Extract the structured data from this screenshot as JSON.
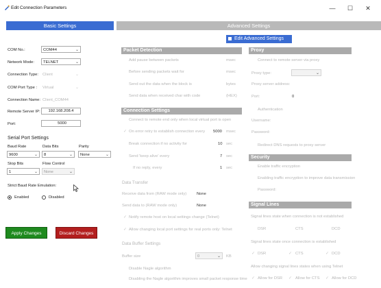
{
  "window": {
    "title": "Edit Connection Parameters",
    "minimize": "—",
    "maximize": "☐",
    "close": "✕"
  },
  "tabs": {
    "basic": "Basic Settings",
    "advanced": "Advanced Settings"
  },
  "basic": {
    "com_no_label": "COM No.:",
    "com_no_value": "COM44",
    "network_mode_label": "Network Mode:",
    "network_mode_value": "TELNET",
    "connection_type_label": "Connection Type:",
    "connection_type_value": "Client",
    "com_port_type_label": "COM Port Type :",
    "com_port_type_value": "Virtual",
    "connection_name_label": "Connection Name:",
    "connection_name_value": "Client_COM44",
    "remote_ip_label": "Remote Server IP:",
    "remote_ip_value": "192.168.208.4",
    "port_label": "Port:",
    "port_value": "5000",
    "serial_title": "Serial Port Settings",
    "baud_label": "Baud Rate",
    "baud_value": "9600",
    "databits_label": "Data Bits",
    "databits_value": "8",
    "parity_label": "Parity",
    "parity_value": "None",
    "stopbits_label": "Stop Bits",
    "stopbits_value": "1",
    "flow_label": "Flow Control",
    "flow_value": "None",
    "strict_label": "Strict Baud Rate Emulation:",
    "enabled_label": "Enabled",
    "disabled_label": "Disabled"
  },
  "buttons": {
    "apply": "Apply Changes",
    "discard": "Discard Changes",
    "enable_advanced": "Edit Advanced Settings"
  },
  "packet": {
    "title": "Packet Detection",
    "pause_label": "Add pause between packets",
    "pause_unit": "msec",
    "before_label": "Before sending packets wait for",
    "before_unit": "msec",
    "sendout_label": "Send out the data when the block is",
    "sendout_unit": "bytes",
    "char_label": "Send data when received char with code",
    "char_unit": "(HEX)"
  },
  "conn": {
    "title": "Connection Settings",
    "remote_only": "Connect to remote end only when local virtual port is open",
    "error_label": "On error retry to establish connection every",
    "error_value": "5000",
    "error_unit": "msec",
    "break_label": "Break connection if no activity for",
    "break_value": "10",
    "break_unit": "sec",
    "keepalive_label": "Send 'keep alive' every",
    "keepalive_value": "7",
    "keepalive_unit": "sec",
    "reply_label": "If no reply, every",
    "reply_value": "1",
    "reply_unit": "sec"
  },
  "transfer": {
    "title": "Data Transfer",
    "receive_label": "Receive data from (RAW mode only)",
    "receive_value": "None",
    "send_label": "Send data to (RAW mode only)",
    "send_value": "None",
    "notify_label": "Notify remote host on local settings change (Telnet)",
    "allow_label": "Allow changing local port settings for real ports only: Telnet"
  },
  "buffer": {
    "title": "Data Buffer Settings",
    "size_label": "Buffer size",
    "size_value": "0",
    "size_unit": "KB",
    "nagle_label": "Disable Nagle algorithm",
    "nagle_desc": "Disabling the Nagle algorithm improves small packet response time"
  },
  "proxy": {
    "title": "Proxy",
    "via_label": "Connect to remote server via proxy",
    "type_label": "Proxy type:",
    "address_label": "Proxy server address:",
    "port_label": "Port:",
    "port_value": "0",
    "auth_label": "Authentication",
    "username_label": "Username:",
    "password_label": "Password:",
    "dns_label": "Redirect DNS requests to proxy server"
  },
  "security": {
    "title": "Security",
    "enable_label": "Enable traffic encryption",
    "desc_label": "Enabling traffic encryption to improve data transmission",
    "password_label": "Password:"
  },
  "signal": {
    "title": "Signal Lines",
    "not_established": "Signal lines state when connection is not established",
    "established": "Signal lines state once connection is established",
    "allow": "Allow changing signal lines states when using Telnet",
    "dsr": "DSR",
    "cts": "CTS",
    "dcd": "DCD",
    "allow_dsr": "Allow for DSR",
    "allow_cts": "Allow for CTS",
    "allow_dcd": "Allow for DCD"
  },
  "colors": {
    "accent": "#3a6cd2",
    "apply": "#1e8a1e",
    "discard": "#b31e1e",
    "section": "#aaaaaa"
  }
}
